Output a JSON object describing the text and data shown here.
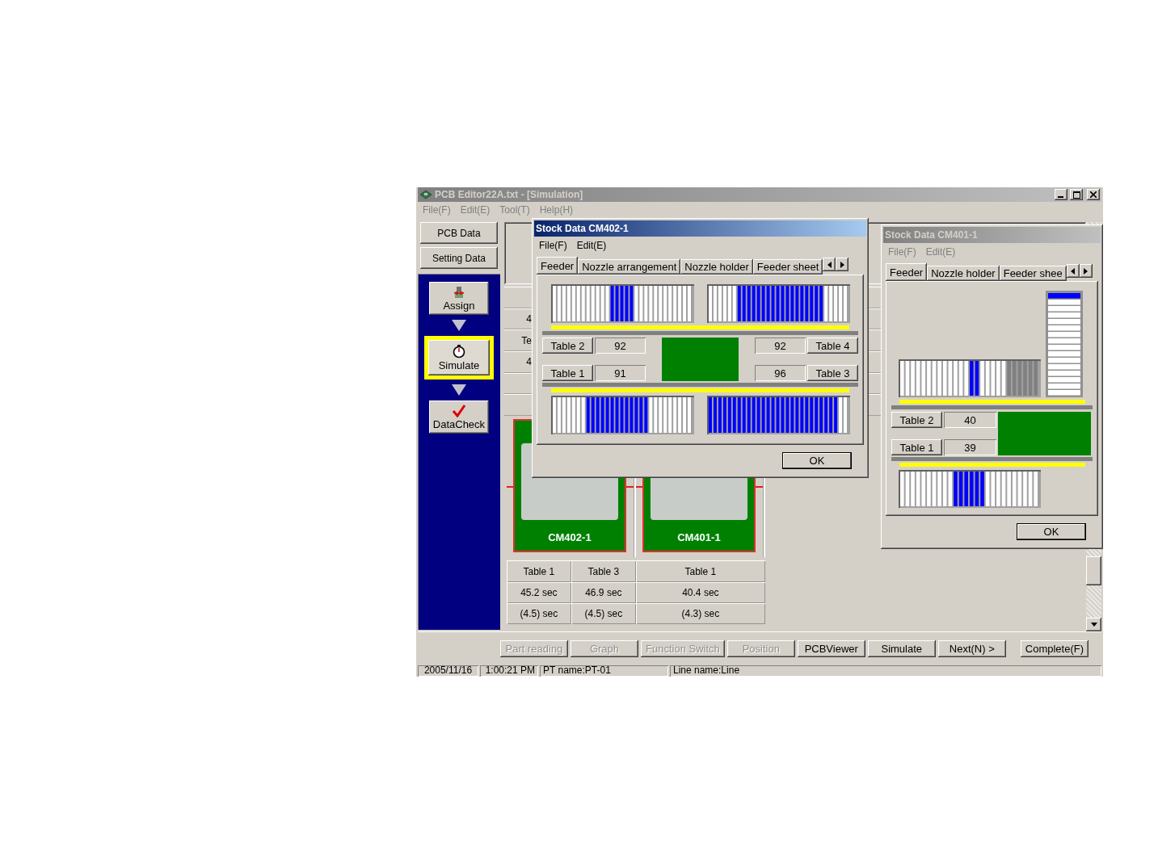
{
  "window": {
    "title": "PCB Editor22A.txt - [Simulation]",
    "active": false
  },
  "menu": [
    "File(F)",
    "Edit(E)",
    "Tool(T)",
    "Help(H)"
  ],
  "sidebar": {
    "top_buttons": [
      "PCB Data",
      "Setting Data"
    ],
    "steps": [
      {
        "label": "Assign",
        "kind": "assign",
        "selected": false
      },
      {
        "label": "Simulate",
        "kind": "simulate",
        "selected": true
      },
      {
        "label": "DataCheck",
        "kind": "check",
        "selected": false
      }
    ]
  },
  "summary_column": [
    "4",
    "Te",
    "4"
  ],
  "machines": [
    {
      "name": "CM402-1"
    },
    {
      "name": "CM401-1"
    }
  ],
  "cycle_table": {
    "columns": [
      "Table 1",
      "Table 3",
      "Table 1"
    ],
    "rows": [
      [
        "45.2 sec",
        "46.9 sec",
        "40.4 sec"
      ],
      [
        "(4.5) sec",
        "(4.5) sec",
        "(4.3) sec"
      ]
    ]
  },
  "toolbar": [
    {
      "label": "Part reading",
      "disabled": true
    },
    {
      "label": "Graph",
      "disabled": true
    },
    {
      "label": "Function Switch",
      "disabled": true
    },
    {
      "label": "Position",
      "disabled": true
    },
    {
      "label": "PCBViewer",
      "disabled": false
    },
    {
      "label": "Simulate",
      "disabled": false
    },
    {
      "label": "Next(N) >",
      "disabled": false
    },
    {
      "label": "Complete(F)",
      "disabled": false
    }
  ],
  "status_bar": [
    "2005/11/16",
    "1:00:21 PM",
    "PT name:PT-01",
    "Line name:Line"
  ],
  "dialogs": [
    {
      "title": "Stock Data CM402-1",
      "active": true,
      "kind": "dual",
      "menu": [
        "File(F)",
        "Edit(E)"
      ],
      "tabs": [
        {
          "label": "Feeder",
          "selected": true
        },
        {
          "label": "Nozzle arrangement",
          "selected": false
        },
        {
          "label": "Nozzle holder",
          "selected": false
        },
        {
          "label": "Feeder sheet",
          "selected": false
        }
      ],
      "left_tables": [
        {
          "label": "Table 2",
          "count": "92"
        },
        {
          "label": "Table 1",
          "count": "91"
        }
      ],
      "right_tables": [
        {
          "label": "Table 4",
          "count": "92"
        },
        {
          "label": "Table 3",
          "count": "96"
        }
      ],
      "ok": "OK"
    },
    {
      "title": "Stock Data CM401-1",
      "active": false,
      "kind": "single",
      "menu": [
        "File(F)",
        "Edit(E)"
      ],
      "tabs": [
        {
          "label": "Feeder",
          "selected": true
        },
        {
          "label": "Nozzle holder",
          "selected": false
        },
        {
          "label": "Feeder shee",
          "selected": false
        }
      ],
      "left_tables": [
        {
          "label": "Table 2",
          "count": "40"
        },
        {
          "label": "Table 1",
          "count": "39"
        }
      ],
      "ok": "OK"
    }
  ]
}
